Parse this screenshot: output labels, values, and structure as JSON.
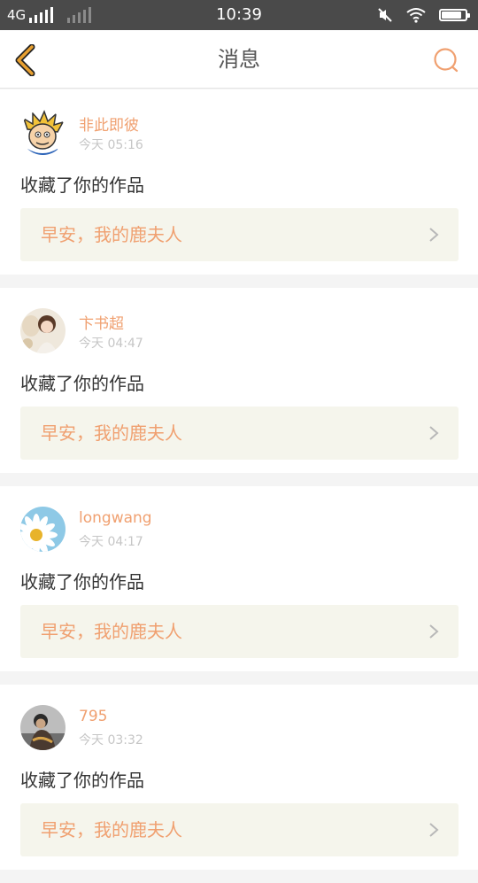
{
  "status_bar": {
    "network": "4G",
    "time": "10:39",
    "battery_level": 0.85,
    "icons": [
      "signal-strong-icon",
      "signal-weak-icon",
      "mute-icon",
      "wifi-icon",
      "battery-icon"
    ]
  },
  "header": {
    "title": "消息",
    "back_icon": "chevron-left-icon",
    "search_icon": "search-icon"
  },
  "colors": {
    "accent": "#f0a070",
    "back": "#e8a030",
    "card_bg": "#ffffff",
    "link_bg": "#f5f5ec"
  },
  "messages": [
    {
      "username": "非此即彼",
      "time": "今天 05:16",
      "action": "收藏了你的作品",
      "work": "早安，我的鹿夫人",
      "avatar": "cartoon-avatar"
    },
    {
      "username": "卞书超",
      "time": "今天 04:47",
      "action": "收藏了你的作品",
      "work": "早安，我的鹿夫人",
      "avatar": "child-photo-avatar"
    },
    {
      "username": "longwang",
      "time": "今天 04:17",
      "action": "收藏了你的作品",
      "work": "早安，我的鹿夫人",
      "avatar": "daisy-avatar"
    },
    {
      "username": "795",
      "time": "今天 03:32",
      "action": "收藏了你的作品",
      "work": "早安，我的鹿夫人",
      "avatar": "person-photo-avatar"
    }
  ]
}
